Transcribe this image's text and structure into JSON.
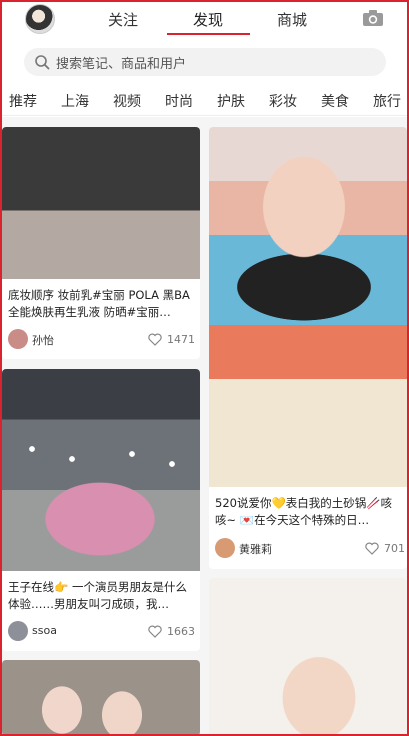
{
  "header": {
    "tabs": [
      {
        "label": "关注"
      },
      {
        "label": "发现"
      },
      {
        "label": "商城"
      }
    ],
    "active_tab": "发现"
  },
  "search": {
    "placeholder": "搜索笔记、商品和用户"
  },
  "categories": [
    "推荐",
    "上海",
    "视频",
    "时尚",
    "护肤",
    "彩妆",
    "美食",
    "旅行"
  ],
  "colors": {
    "accent": "#d9232e",
    "feed_background": "#f5f5f5"
  },
  "feed": {
    "cards": [
      {
        "title": "底妆顺序 妆前乳#宝丽 POLA 黑BA全能焕肤再生乳液 防晒#宝丽…",
        "author": "孙怡",
        "likes": "1471"
      },
      {
        "title": "520说爱你💛表白我的土砂锅🥢咳咳~ 💌在今天这个特殊的日…",
        "author": "黄雅莉",
        "likes": "701"
      },
      {
        "title": "王子在线👉 一个演员男朋友是什么体验……男朋友叫刁成硕，我…",
        "author": "ssoa",
        "likes": "1663"
      },
      {
        "title": "",
        "author": "",
        "likes": ""
      },
      {
        "title": "",
        "author": "",
        "likes": ""
      }
    ]
  },
  "icons": {
    "camera": "camera-icon",
    "search": "search-icon",
    "heart": "heart-icon"
  }
}
